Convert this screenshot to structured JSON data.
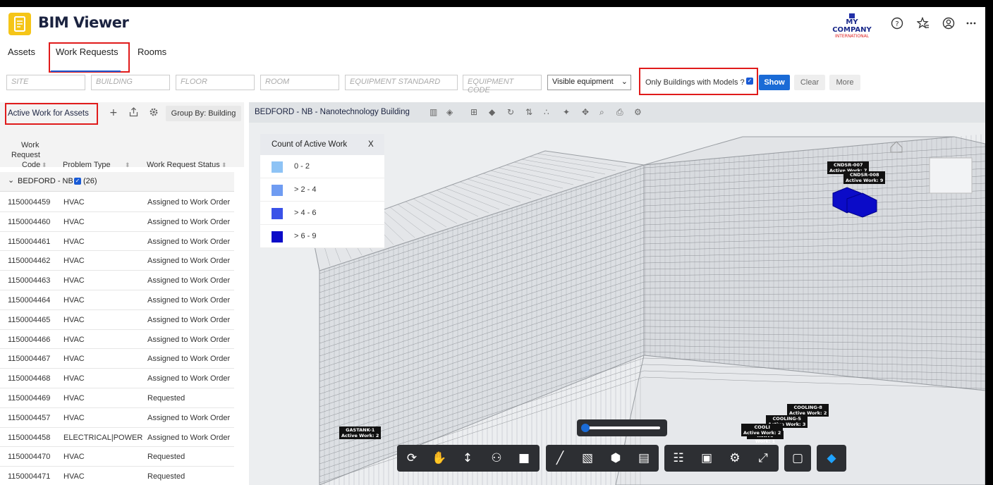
{
  "header": {
    "app_title": "BIM Viewer",
    "company_name": "MY COMPANY",
    "company_sub": "INTERNATIONAL",
    "icons": [
      "help-icon",
      "favorites-icon",
      "user-icon",
      "more-icon"
    ]
  },
  "tabs": [
    {
      "label": "Assets"
    },
    {
      "label": "Work Requests"
    },
    {
      "label": "Rooms"
    }
  ],
  "filters": {
    "site": "SITE",
    "building": "BUILDING",
    "floor": "FLOOR",
    "room": "ROOM",
    "equipment_standard": "EQUIPMENT STANDARD",
    "equipment_code": "EQUIPMENT CODE",
    "visible_select": "Visible equipment",
    "only_buildings_label": "Only Buildings with Models ?",
    "only_buildings_checked": true,
    "show": "Show",
    "clear": "Clear",
    "more": "More"
  },
  "panel": {
    "title": "Active Work for Assets",
    "group_by": "Group By: Building",
    "columns": {
      "code_l1": "Work",
      "code_l2": "Request",
      "code_l3": "Code",
      "problem": "Problem Type",
      "status": "Work Request Status"
    },
    "group": {
      "label": "BEDFORD - NB",
      "count": "(26)"
    },
    "rows": [
      {
        "code": "1150004459",
        "type": "HVAC",
        "status": "Assigned to Work Order"
      },
      {
        "code": "1150004460",
        "type": "HVAC",
        "status": "Assigned to Work Order"
      },
      {
        "code": "1150004461",
        "type": "HVAC",
        "status": "Assigned to Work Order"
      },
      {
        "code": "1150004462",
        "type": "HVAC",
        "status": "Assigned to Work Order"
      },
      {
        "code": "1150004463",
        "type": "HVAC",
        "status": "Assigned to Work Order"
      },
      {
        "code": "1150004464",
        "type": "HVAC",
        "status": "Assigned to Work Order"
      },
      {
        "code": "1150004465",
        "type": "HVAC",
        "status": "Assigned to Work Order"
      },
      {
        "code": "1150004466",
        "type": "HVAC",
        "status": "Assigned to Work Order"
      },
      {
        "code": "1150004467",
        "type": "HVAC",
        "status": "Assigned to Work Order"
      },
      {
        "code": "1150004468",
        "type": "HVAC",
        "status": "Assigned to Work Order"
      },
      {
        "code": "1150004469",
        "type": "HVAC",
        "status": "Requested"
      },
      {
        "code": "1150004457",
        "type": "HVAC",
        "status": "Assigned to Work Order"
      },
      {
        "code": "1150004458",
        "type": "ELECTRICAL|POWER",
        "status": "Assigned to Work Order"
      },
      {
        "code": "1150004470",
        "type": "HVAC",
        "status": "Requested"
      },
      {
        "code": "1150004471",
        "type": "HVAC",
        "status": "Requested"
      }
    ]
  },
  "viewer": {
    "title": "BEDFORD - NB - Nanotechnology Building",
    "legend": {
      "title": "Count of Active Work",
      "close": "X",
      "items": [
        {
          "label": "0 - 2",
          "color": "#8ec3f5"
        },
        {
          "label": "> 2 - 4",
          "color": "#6f9cf2"
        },
        {
          "label": "> 4 - 6",
          "color": "#3a52e8"
        },
        {
          "label": "> 6 - 9",
          "color": "#0b0bc8"
        }
      ]
    },
    "tags": {
      "gastank_name": "GASTANK-1",
      "gastank_work": "Active Work: 2",
      "cndsr7_name": "CNDSR-007",
      "cndsr7_work": "Active Work: 7",
      "cndsr8_name": "CNDSR-008",
      "cndsr8_work": "Active Work: 9",
      "cooling8_name": "COOLING-8",
      "cooling8_work": "Active Work: 2",
      "cooling5_name": "COOLING-5",
      "cooling5_work": "Active Work: 3",
      "cooling_a_name": "COOLI",
      "cooling_a_work": "Active Work: 2",
      "cooling_b_work": "Active Work: 1"
    },
    "highlight_color": "#0b0bc8"
  }
}
